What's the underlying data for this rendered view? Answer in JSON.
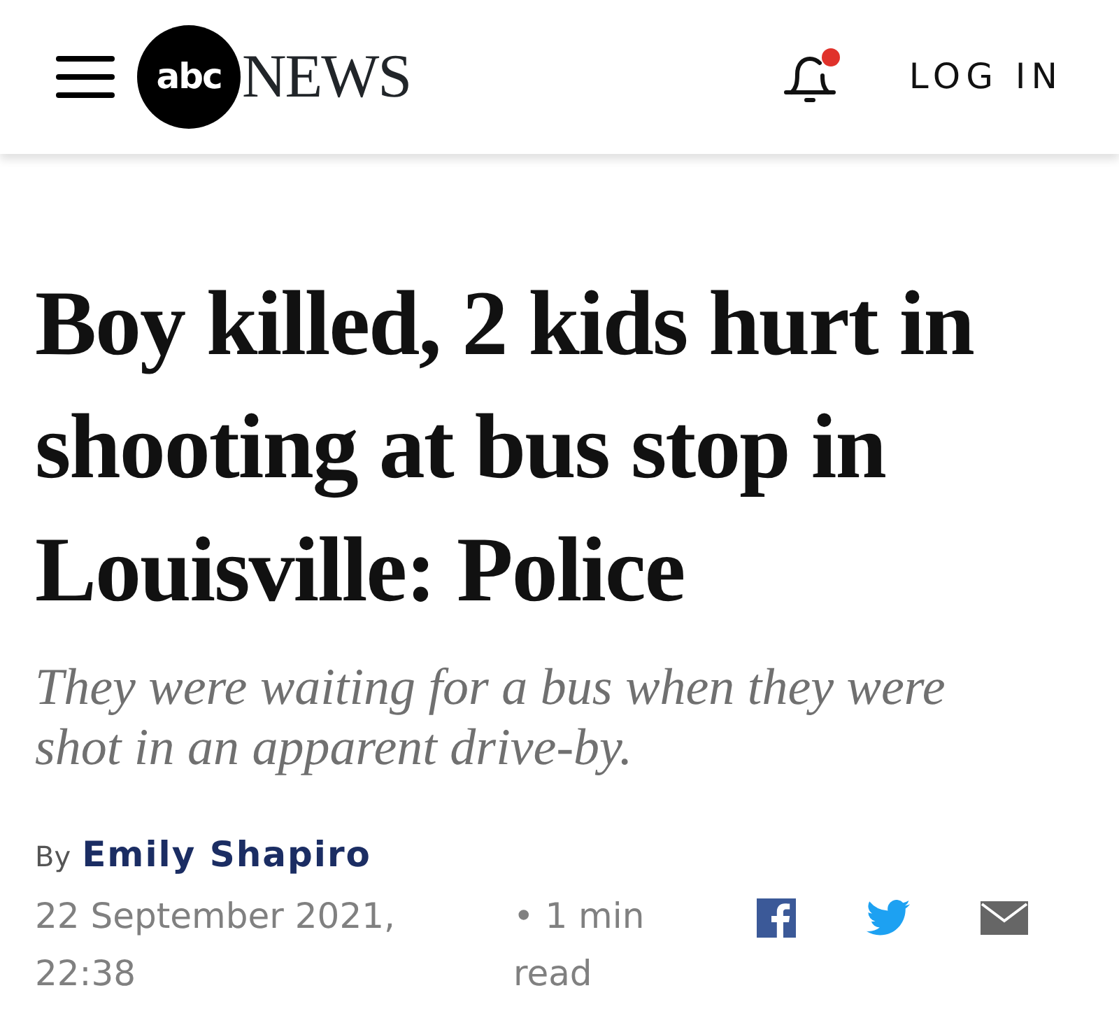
{
  "header": {
    "logo": {
      "mark": "abc",
      "wordmark": "NEWS"
    },
    "notifications": {
      "unread": true
    },
    "login": "LOG IN"
  },
  "article": {
    "headline": "Boy killed, 2 kids hurt in shooting at bus stop in Louisville: Police",
    "subheadline": "They were waiting for a bus when they were shot in an apparent drive-by.",
    "byline": {
      "prefix": "By",
      "author": "Emily Shapiro"
    },
    "date": "22 September 2021, 22:38",
    "read_time": "• 1 min read",
    "share": [
      {
        "kind": "facebook"
      },
      {
        "kind": "twitter"
      },
      {
        "kind": "email"
      }
    ]
  }
}
